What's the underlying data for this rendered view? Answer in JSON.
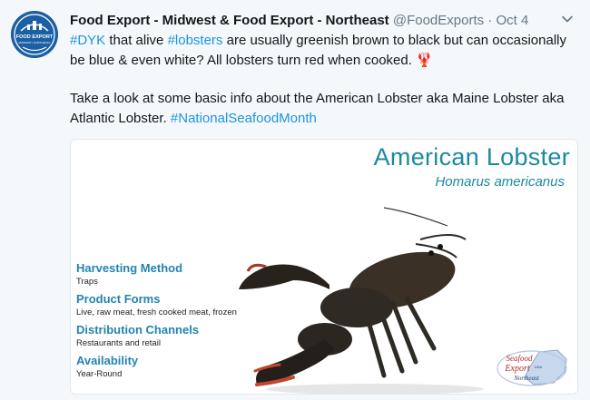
{
  "tweet": {
    "author_name": "Food Export - Midwest & Food Export - Northeast",
    "handle": "@FoodExports",
    "separator": "·",
    "date": "Oct 4",
    "line1_parts": [
      "#DYK",
      " that alive ",
      "#lobsters",
      " are usually greenish brown to black but can occasionally be blue & even white?  All lobsters turn red when cooked. 🦞"
    ],
    "line2_parts": [
      "Take a look at some basic info about the American Lobster aka Maine Lobster aka Atlantic Lobster. ",
      "#NationalSeafoodMonth"
    ]
  },
  "avatar": {
    "logo_line1": "FOOD EXPORT",
    "logo_line2": "MIDWEST | NORTHEAST"
  },
  "card": {
    "title": "American Lobster",
    "subtitle": "Homarus americanus",
    "sections": [
      {
        "heading": "Harvesting Method",
        "value": "Traps"
      },
      {
        "heading": "Product Forms",
        "value": "Live, raw meat, fresh cooked meat, frozen"
      },
      {
        "heading": "Distribution Channels",
        "value": "Restaurants and retail"
      },
      {
        "heading": "Availability",
        "value": "Year-Round"
      }
    ],
    "seal_line1": "Seafood",
    "seal_line2": "Export",
    "seal_line3": "Northeast",
    "seal_small": "USA"
  },
  "colors": {
    "link": "#1b95e0",
    "card_title": "#1b8aa0",
    "section_heading": "#2383b0"
  },
  "icons": {
    "caret": "chevron-down-icon",
    "emoji": "lobster-emoji"
  }
}
